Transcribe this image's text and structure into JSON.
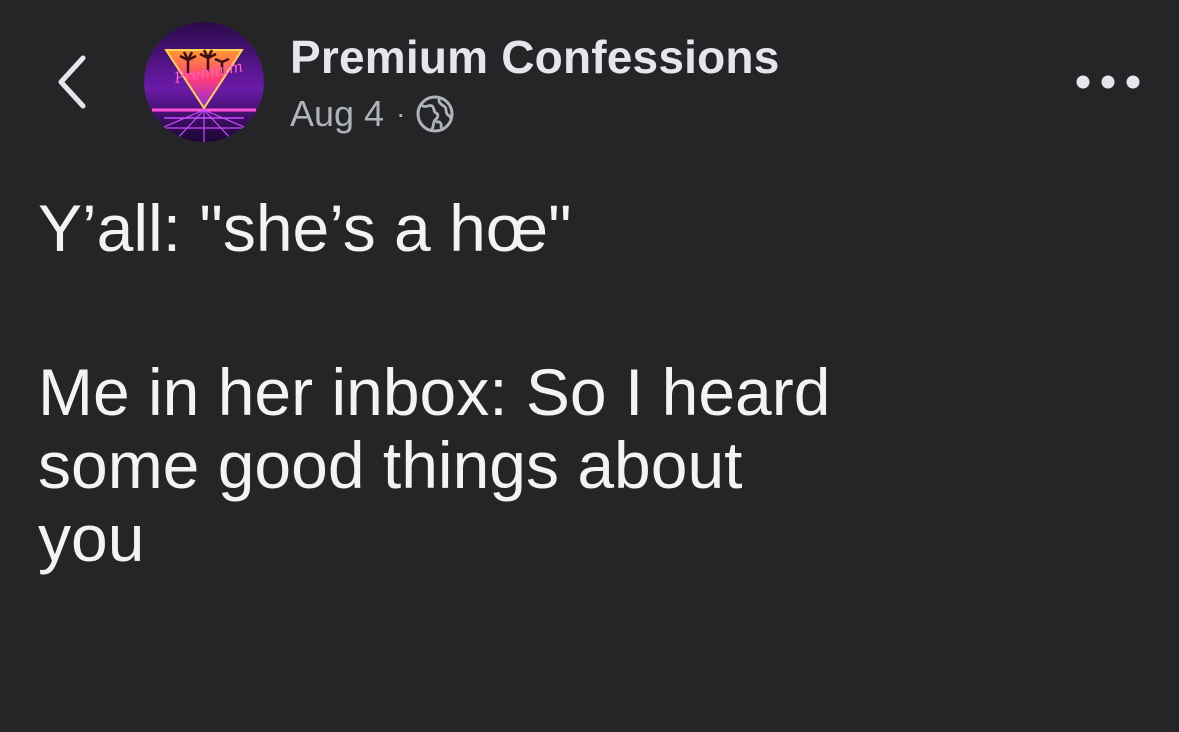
{
  "header": {
    "back_icon": "chevron-left-icon",
    "avatar_text": "Premium",
    "page_name": "Premium Confessions",
    "date": "Aug 4",
    "separator": "·",
    "privacy_icon": "globe-icon",
    "more_icon": "more-horizontal-icon"
  },
  "post": {
    "line1": "Y’all: \"she’s a hœ\"",
    "line2": "Me in her inbox: So I heard",
    "line3": "some good things about",
    "line4": "you"
  },
  "colors": {
    "background": "#242526",
    "primary_text": "#e4e6eb",
    "secondary_text": "#b0b3b8"
  }
}
